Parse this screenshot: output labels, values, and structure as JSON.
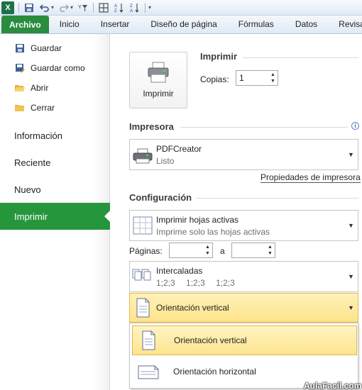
{
  "qat": {
    "icons": [
      "excel-logo",
      "save-icon",
      "undo-icon",
      "redo-icon",
      "filter-icon",
      "borders-icon",
      "sort-asc-icon",
      "sort-desc-icon",
      "customize-icon"
    ],
    "logo_text": "X"
  },
  "ribbon": {
    "tabs": [
      "Archivo",
      "Inicio",
      "Insertar",
      "Diseño de página",
      "Fórmulas",
      "Datos",
      "Revisar"
    ],
    "file_color": "#2a8c3e"
  },
  "sidebar": {
    "items": [
      {
        "label": "Guardar",
        "icon": "save-icon"
      },
      {
        "label": "Guardar como",
        "icon": "save-as-icon"
      },
      {
        "label": "Abrir",
        "icon": "open-folder-icon"
      },
      {
        "label": "Cerrar",
        "icon": "close-folder-icon"
      }
    ],
    "sections": [
      "Información",
      "Reciente",
      "Nuevo",
      "Imprimir"
    ],
    "active": "Imprimir",
    "active_color": "#26963d"
  },
  "print": {
    "heading": "Imprimir",
    "button_label": "Imprimir",
    "copies_label": "Copias:",
    "copies_value": "1"
  },
  "printer": {
    "heading": "Impresora",
    "name": "PDFCreator",
    "status": "Listo",
    "properties_link": "Propiedades de impresora"
  },
  "settings": {
    "heading": "Configuración",
    "sheets": {
      "title": "Imprimir hojas activas",
      "subtitle": "Imprime solo las hojas activas"
    },
    "pages_label": "Páginas:",
    "pages_to": "a",
    "pages_from_value": "",
    "pages_to_value": "",
    "collate": {
      "title": "Intercaladas",
      "seq1": "1;2;3",
      "seq2": "1;2;3",
      "seq3": "1;2;3"
    },
    "orientation": {
      "selected": "Orientación vertical",
      "options": [
        "Orientación vertical",
        "Orientación horizontal"
      ],
      "highlight": "#fde38b"
    }
  },
  "watermark": "AulaFacil.com"
}
